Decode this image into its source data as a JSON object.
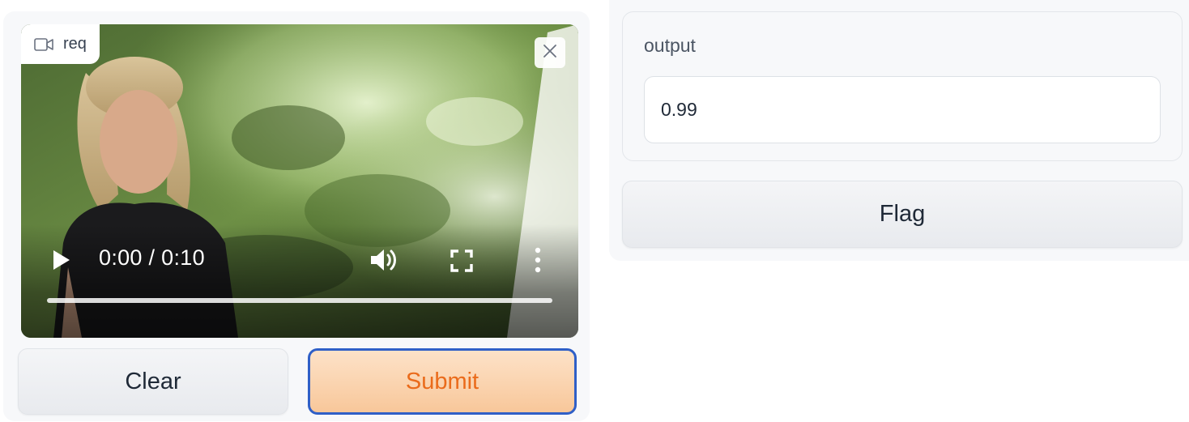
{
  "video_input": {
    "label": "req",
    "time_display": "0:00 / 0:10",
    "progress": 0.0
  },
  "buttons": {
    "clear_label": "Clear",
    "submit_label": "Submit",
    "flag_label": "Flag"
  },
  "output": {
    "label": "output",
    "value": "0.99"
  },
  "icons": {
    "video": "video-camera-icon",
    "close": "close-icon",
    "play": "play-icon",
    "volume": "volume-icon",
    "fullscreen": "fullscreen-icon",
    "more": "more-vertical-icon"
  },
  "colors": {
    "submit_text": "#ea6b1b",
    "submit_bg": "#f8c79a",
    "submit_border": "#2f5fc7",
    "panel_bg": "#f7f8fa"
  }
}
